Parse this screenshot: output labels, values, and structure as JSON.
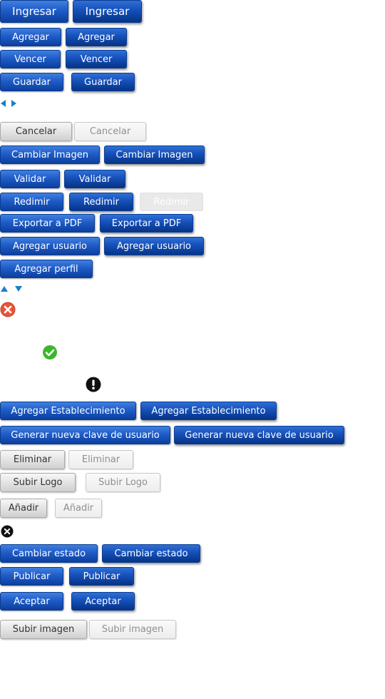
{
  "buttons": {
    "ingresar": "Ingresar",
    "agregar": "Agregar",
    "vencer": "Vencer",
    "guardar": "Guardar",
    "cancelar": "Cancelar",
    "cambiar_imagen": "Cambiar Imagen",
    "validar": "Validar",
    "redimir": "Redimir",
    "exportar_pdf": "Exportar a PDF",
    "agregar_usuario": "Agregar usuario",
    "agregar_perfil": "Agregar perfil",
    "agregar_establecimiento": "Agregar Establecimiento",
    "generar_clave": "Generar nueva clave de usuario",
    "eliminar": "Eliminar",
    "subir_logo": "Subir Logo",
    "anadir": "Añadir",
    "cambiar_estado": "Cambiar estado",
    "publicar": "Publicar",
    "aceptar": "Aceptar",
    "subir_imagen": "Subir imagen"
  },
  "icons": {
    "arrow_left": "arrow-left-icon",
    "arrow_right": "arrow-right-icon",
    "arrow_up": "arrow-up-icon",
    "arrow_down": "arrow-down-icon",
    "error": "error-circle-icon",
    "success": "check-circle-icon",
    "alert": "exclamation-circle-icon",
    "close": "close-circle-icon"
  },
  "colors": {
    "button_blue": "#1f5cc7",
    "button_grey": "#e2e2e2",
    "arrow_blue": "#1a80c8",
    "error_orange": "#e8553a",
    "success_green": "#3cb72c",
    "alert_black": "#111111"
  }
}
